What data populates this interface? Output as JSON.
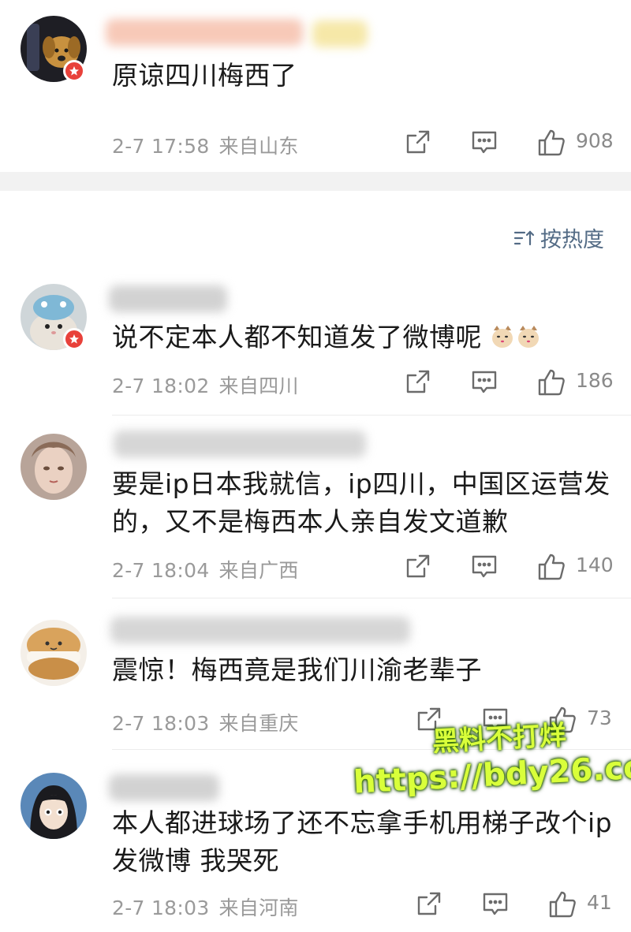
{
  "top_comment": {
    "text": "原谅四川梅西了",
    "date": "2-7 17:58",
    "location": "来自山东",
    "likes": "908"
  },
  "sort": {
    "label": "按热度"
  },
  "comments": [
    {
      "text": "说不定本人都不知道发了微博呢",
      "date": "2-7 18:02",
      "location": "来自四川",
      "likes": "186"
    },
    {
      "text": "要是ip日本我就信，ip四川，中国区运营发的，又不是梅西本人亲自发文道歉",
      "date": "2-7 18:04",
      "location": "来自广西",
      "likes": "140"
    },
    {
      "text": "震惊！梅西竟是我们川渝老辈子",
      "date": "2-7 18:03",
      "location": "来自重庆",
      "likes": "73"
    },
    {
      "text": "本人都进球场了还不忘拿手机用梯子改个ip发微博 我哭死",
      "date": "2-7 18:03",
      "location": "来自河南",
      "likes": "41"
    }
  ],
  "watermark": {
    "line1": "黑料不打烊",
    "line2": "https://bdy26.co"
  },
  "icons": {
    "share": "share-icon",
    "comment": "comment-icon",
    "like": "thumbs-up-icon",
    "sort": "sort-icon",
    "verified": "verified-badge-icon",
    "emoji": "cat-emoji-icon"
  },
  "colors": {
    "accent_badge": "#e8413a",
    "sort_link": "#536b85",
    "meta_gray": "#9a9a9a",
    "watermark": "#d9ff3a"
  }
}
